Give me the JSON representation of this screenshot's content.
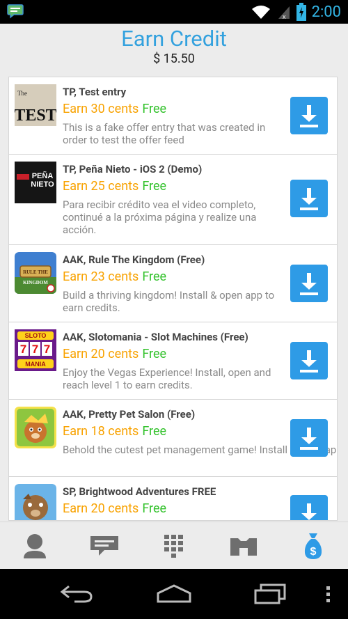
{
  "status_bar": {
    "time": "2:00",
    "icons": [
      "chat-notification-icon",
      "wifi-icon",
      "signal-icon",
      "battery-icon"
    ]
  },
  "header": {
    "title": "Earn Credit",
    "balance": "$ 15.50"
  },
  "offers": [
    {
      "thumb": "test-thumb",
      "thumb_text": "TEST",
      "name": "TP, Test entry",
      "earn": "Earn 30 cents",
      "free": "Free",
      "desc": "This is a fake offer entry that was created in order to test the offer feed"
    },
    {
      "thumb": "nieto-thumb",
      "thumb_text": "PEÑA NIETO",
      "name": "TP, Peña Nieto - iOS 2 (Demo)",
      "earn": "Earn 25 cents",
      "free": "Free",
      "desc": "Para recibir crédito vea el video completo, continué a la próxima página y realize una acción."
    },
    {
      "thumb": "kingdom-thumb",
      "thumb_text": "RULE THE KINGDOM",
      "name": "AAK, Rule The Kingdom (Free)",
      "earn": "Earn 23 cents",
      "free": "Free",
      "desc": "Build a thriving kingdom! Install & open app to earn credits."
    },
    {
      "thumb": "sloto-thumb",
      "thumb_text": "SLOTO 777 MANIA",
      "name": "AAK, Slotomania - Slot Machines (Free)",
      "earn": "Earn 20 cents",
      "free": "Free",
      "desc": "Enjoy the Vegas Experience! Install, open and reach level 1 to earn credits."
    },
    {
      "thumb": "pet-thumb",
      "thumb_text": "",
      "name": "AAK, Pretty Pet Salon (Free)",
      "earn": "Earn 18 cents",
      "free": "Free",
      "desc": "Behold the cutest pet management game! Install & open app to earn credits."
    },
    {
      "thumb": "brightwood-thumb",
      "thumb_text": "",
      "name": "SP, Brightwood Adventures FREE",
      "earn": "Earn 20 cents",
      "free": "Free",
      "desc": ""
    }
  ],
  "tabs": [
    {
      "name": "profile",
      "icon": "person-icon",
      "active": false
    },
    {
      "name": "messages",
      "icon": "message-icon",
      "active": false
    },
    {
      "name": "dialpad",
      "icon": "dialpad-icon",
      "active": false
    },
    {
      "name": "store",
      "icon": "storefront-icon",
      "active": false
    },
    {
      "name": "earn-credit",
      "icon": "money-bag-icon",
      "active": true
    }
  ],
  "nav_bar": {
    "buttons": [
      "back-icon",
      "home-icon",
      "recent-apps-icon",
      "overflow-menu-icon"
    ]
  },
  "colors": {
    "accent_blue": "#33a1de",
    "download_blue": "#2e9be6",
    "earn_orange": "#f8a200",
    "free_green": "#34c22d",
    "status_time": "#33b5e5"
  }
}
